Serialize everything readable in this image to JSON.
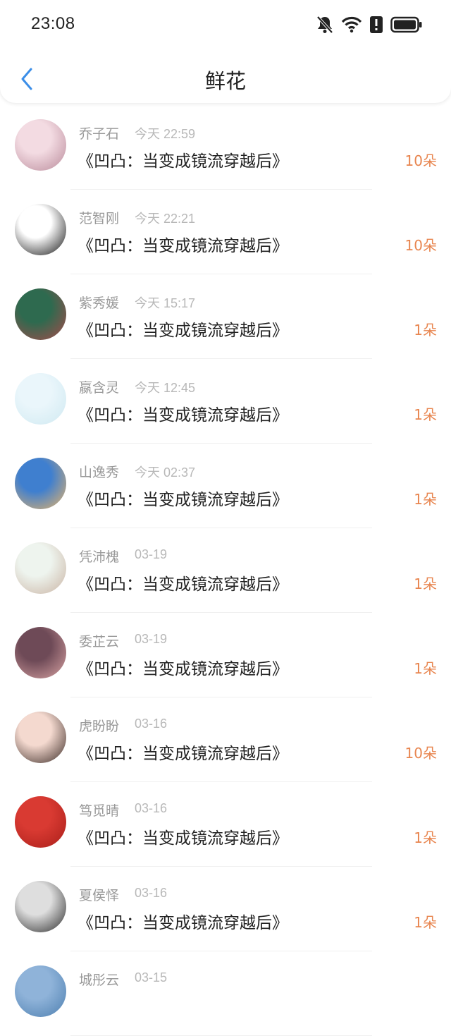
{
  "status_bar": {
    "time": "23:08",
    "icons": [
      "mute-bell-icon",
      "wifi-icon",
      "alert-icon",
      "battery-icon"
    ]
  },
  "header": {
    "title": "鲜花",
    "back_icon": "chevron-left-icon"
  },
  "colors": {
    "accent_blue": "#3b8ee8",
    "count_orange": "#e8854f"
  },
  "list": [
    {
      "name": "乔子石",
      "time": "今天 22:59",
      "book": "《凹凸：当变成镜流穿越后》",
      "count": "10朵",
      "avatar": [
        "#f3dbe2",
        "#b98a9a"
      ]
    },
    {
      "name": "范智刚",
      "time": "今天 22:21",
      "book": "《凹凸：当变成镜流穿越后》",
      "count": "10朵",
      "avatar": [
        "#ffffff",
        "#111111"
      ]
    },
    {
      "name": "紫秀媛",
      "time": "今天 15:17",
      "book": "《凹凸：当变成镜流穿越后》",
      "count": "1朵",
      "avatar": [
        "#2e6a4f",
        "#a84a4a"
      ]
    },
    {
      "name": "嬴含灵",
      "time": "今天 12:45",
      "book": "《凹凸：当变成镜流穿越后》",
      "count": "1朵",
      "avatar": [
        "#eaf6fb",
        "#cfe9f1"
      ]
    },
    {
      "name": "山逸秀",
      "time": "今天 02:37",
      "book": "《凹凸：当变成镜流穿越后》",
      "count": "1朵",
      "avatar": [
        "#3f7fcf",
        "#e9b467"
      ]
    },
    {
      "name": "凭沛槐",
      "time": "03-19",
      "book": "《凹凸：当变成镜流穿越后》",
      "count": "1朵",
      "avatar": [
        "#eef4ee",
        "#c9b3a3"
      ]
    },
    {
      "name": "委芷云",
      "time": "03-19",
      "book": "《凹凸：当变成镜流穿越后》",
      "count": "1朵",
      "avatar": [
        "#6e4a57",
        "#d9a3a3"
      ]
    },
    {
      "name": "虎盼盼",
      "time": "03-16",
      "book": "《凹凸：当变成镜流穿越后》",
      "count": "10朵",
      "avatar": [
        "#f4d9cf",
        "#3a2a25"
      ]
    },
    {
      "name": "笃觅晴",
      "time": "03-16",
      "book": "《凹凸：当变成镜流穿越后》",
      "count": "1朵",
      "avatar": [
        "#d93a32",
        "#a91f1a"
      ]
    },
    {
      "name": "夏侯怿",
      "time": "03-16",
      "book": "《凹凸：当变成镜流穿越后》",
      "count": "1朵",
      "avatar": [
        "#dedede",
        "#2a2a2a"
      ]
    },
    {
      "name": "城彤云",
      "time": "03-15",
      "book": "",
      "count": "",
      "avatar": [
        "#8fb3d9",
        "#4d7fb0"
      ]
    }
  ]
}
